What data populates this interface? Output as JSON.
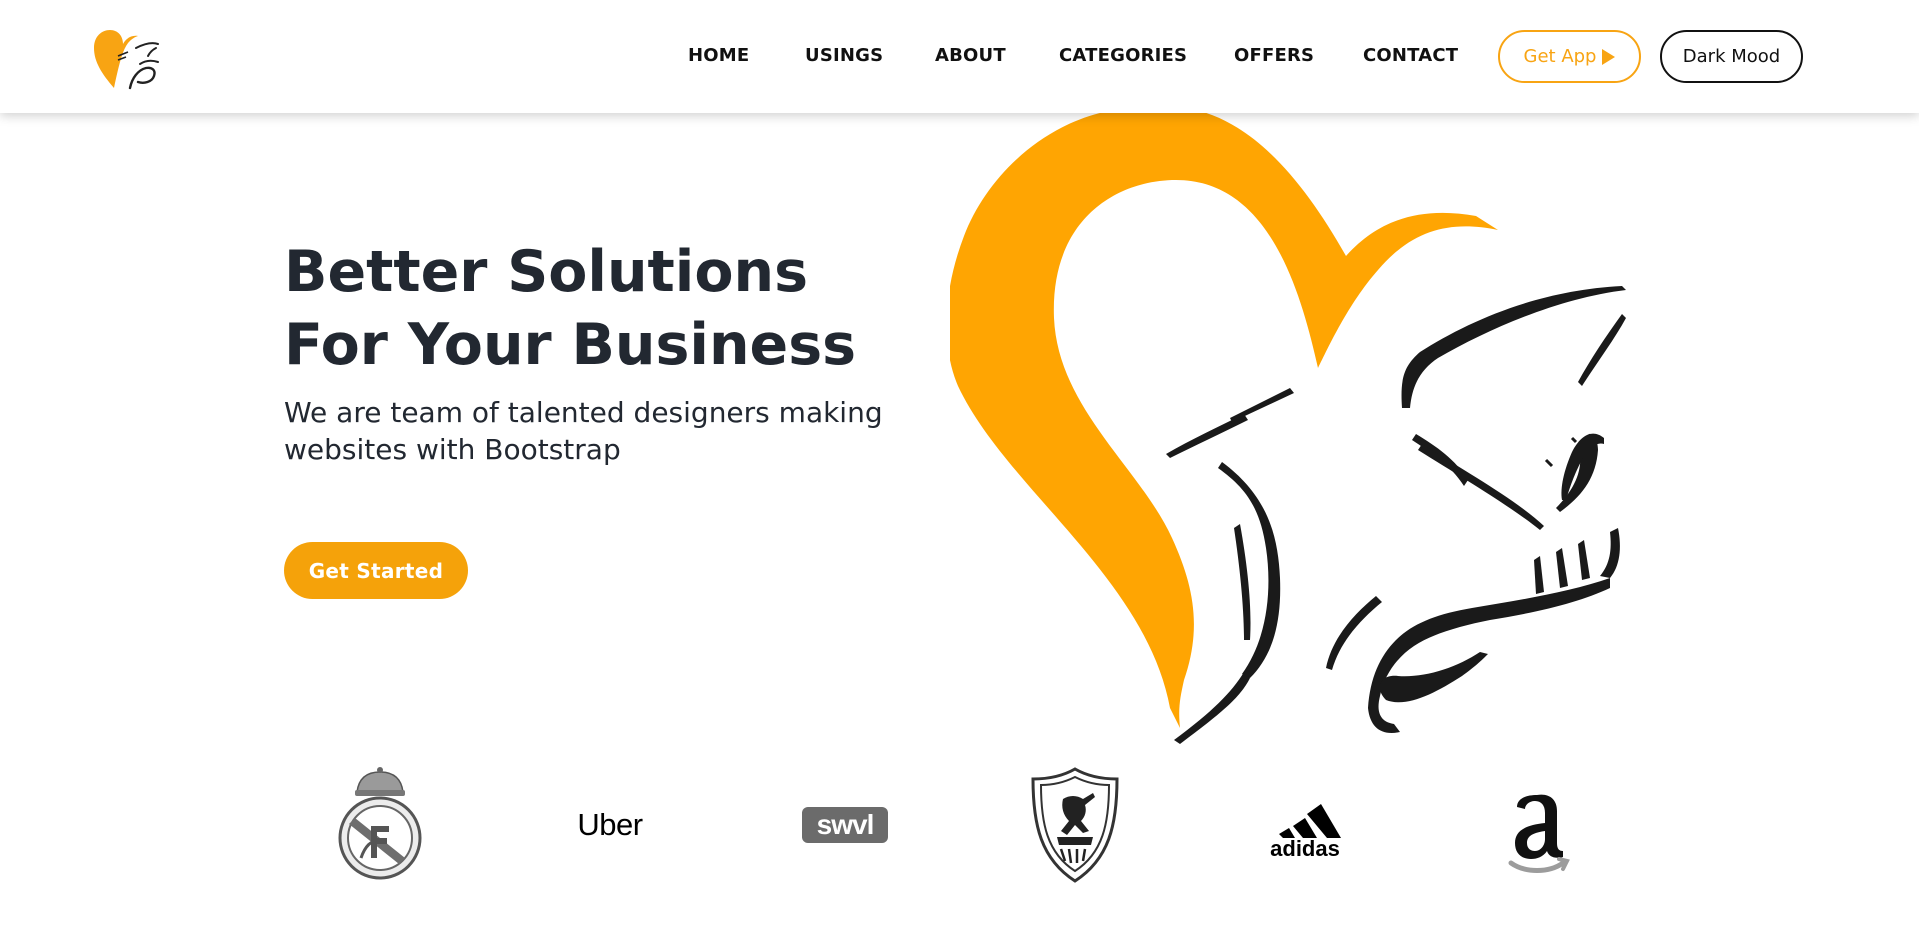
{
  "header": {
    "logo_icon": "heart-calligraphy-logo",
    "nav": {
      "home": "HOME",
      "usings": "USINGS",
      "about": "ABOUT",
      "categories": "CATEGORIES",
      "offers": "OFFERS",
      "contact": "CONTACT"
    },
    "get_app_label": "Get App",
    "get_app_icon": "play-icon",
    "dark_mode_label": "Dark Mood"
  },
  "hero": {
    "title": "Better Solutions For Your Business",
    "subtitle": "We are team of talented designers making websites with Bootstrap",
    "cta_label": "Get Started",
    "illustration": "heart-calligraphy-illustration"
  },
  "clients": {
    "logos": [
      "real-madrid",
      "uber",
      "swvl",
      "zamalek",
      "adidas",
      "amazon"
    ],
    "uber_text": "Uber",
    "swvl_text": "swvl",
    "adidas_text": "adidas"
  },
  "colors": {
    "accent": "#f8a413",
    "button": "#f5a20a",
    "text": "#222831",
    "nav_text": "#111111"
  }
}
